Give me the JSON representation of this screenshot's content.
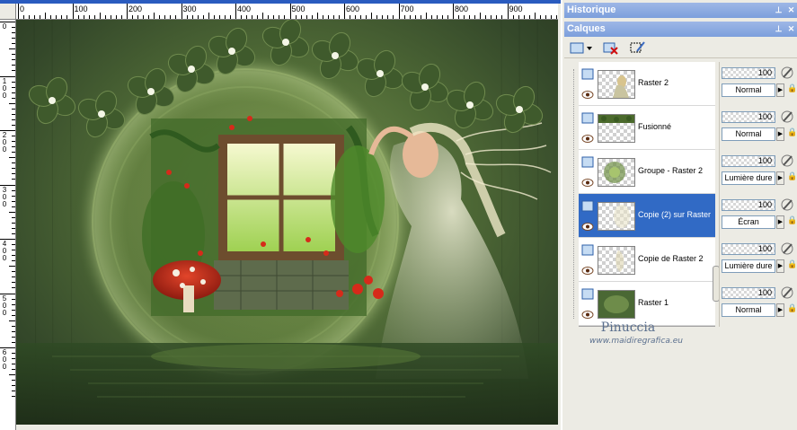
{
  "ruler": {
    "h_labels": [
      "0",
      "100",
      "200",
      "300",
      "400",
      "500",
      "600",
      "700",
      "800",
      "900"
    ],
    "v_labels": [
      "0",
      "1 0 0",
      "2 0 0",
      "3 0 0",
      "4 0 0",
      "5 0 0",
      "6 0 0"
    ]
  },
  "image": {
    "watermark_name": "Pinuccia",
    "watermark_url": "www.maidiregrafica.eu"
  },
  "panels": {
    "history_title": "Historique",
    "layers_title": "Calques"
  },
  "layers": [
    {
      "name": "Raster 2",
      "opacity": "100",
      "blend": "Normal",
      "selected": false,
      "thumb": "figure"
    },
    {
      "name": "Fusionné",
      "opacity": "100",
      "blend": "Normal",
      "selected": false,
      "thumb": "vine"
    },
    {
      "name": "Groupe - Raster 2",
      "opacity": "100",
      "blend": "Lumière dure",
      "selected": false,
      "thumb": "orb"
    },
    {
      "name": "Copie (2) sur Raster",
      "opacity": "100",
      "blend": "Écran",
      "selected": true,
      "thumb": "ghost"
    },
    {
      "name": "Copie de Raster 2",
      "opacity": "100",
      "blend": "Lumière dure",
      "selected": false,
      "thumb": "ghost2"
    },
    {
      "name": "Raster 1",
      "opacity": "100",
      "blend": "Normal",
      "selected": false,
      "thumb": "green"
    }
  ],
  "colors": {
    "title_blue": "#2a5bbf",
    "panel_header": "#7c9fdc",
    "selection": "#316ac5",
    "image_green": "#4f6a36"
  }
}
